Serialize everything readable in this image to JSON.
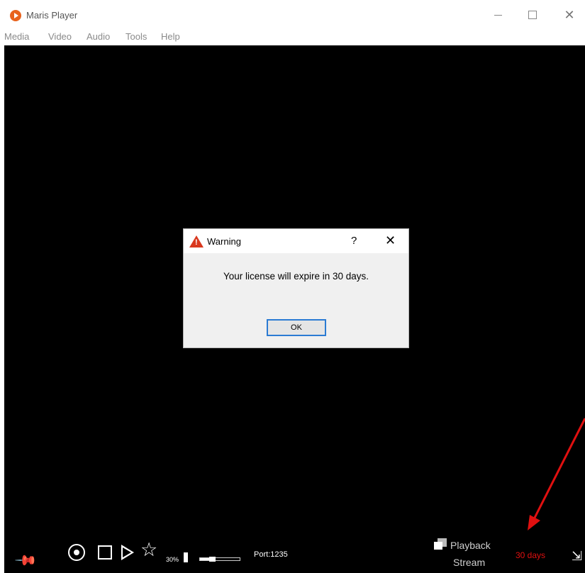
{
  "window": {
    "title": "Maris Player",
    "icon": "play-logo-icon",
    "accent": "#e8621d"
  },
  "menu": {
    "items": [
      "Media",
      "Video",
      "Audio",
      "Tools",
      "Help"
    ]
  },
  "dialog": {
    "title": "Warning",
    "help": "?",
    "close": "✕",
    "message": "Your license will expire in 30 days.",
    "ok_label": "OK",
    "icon": "warning-icon",
    "icon_color": "#d9381e"
  },
  "controls": {
    "volume_percent": "30%",
    "volume_level": 0.3,
    "port": "Port:1235",
    "playback_label": "Playback",
    "stream_label": "Stream",
    "license_days": "30 days",
    "license_days_color": "#e01010"
  },
  "annotation": {
    "arrow_color": "#e01010"
  }
}
